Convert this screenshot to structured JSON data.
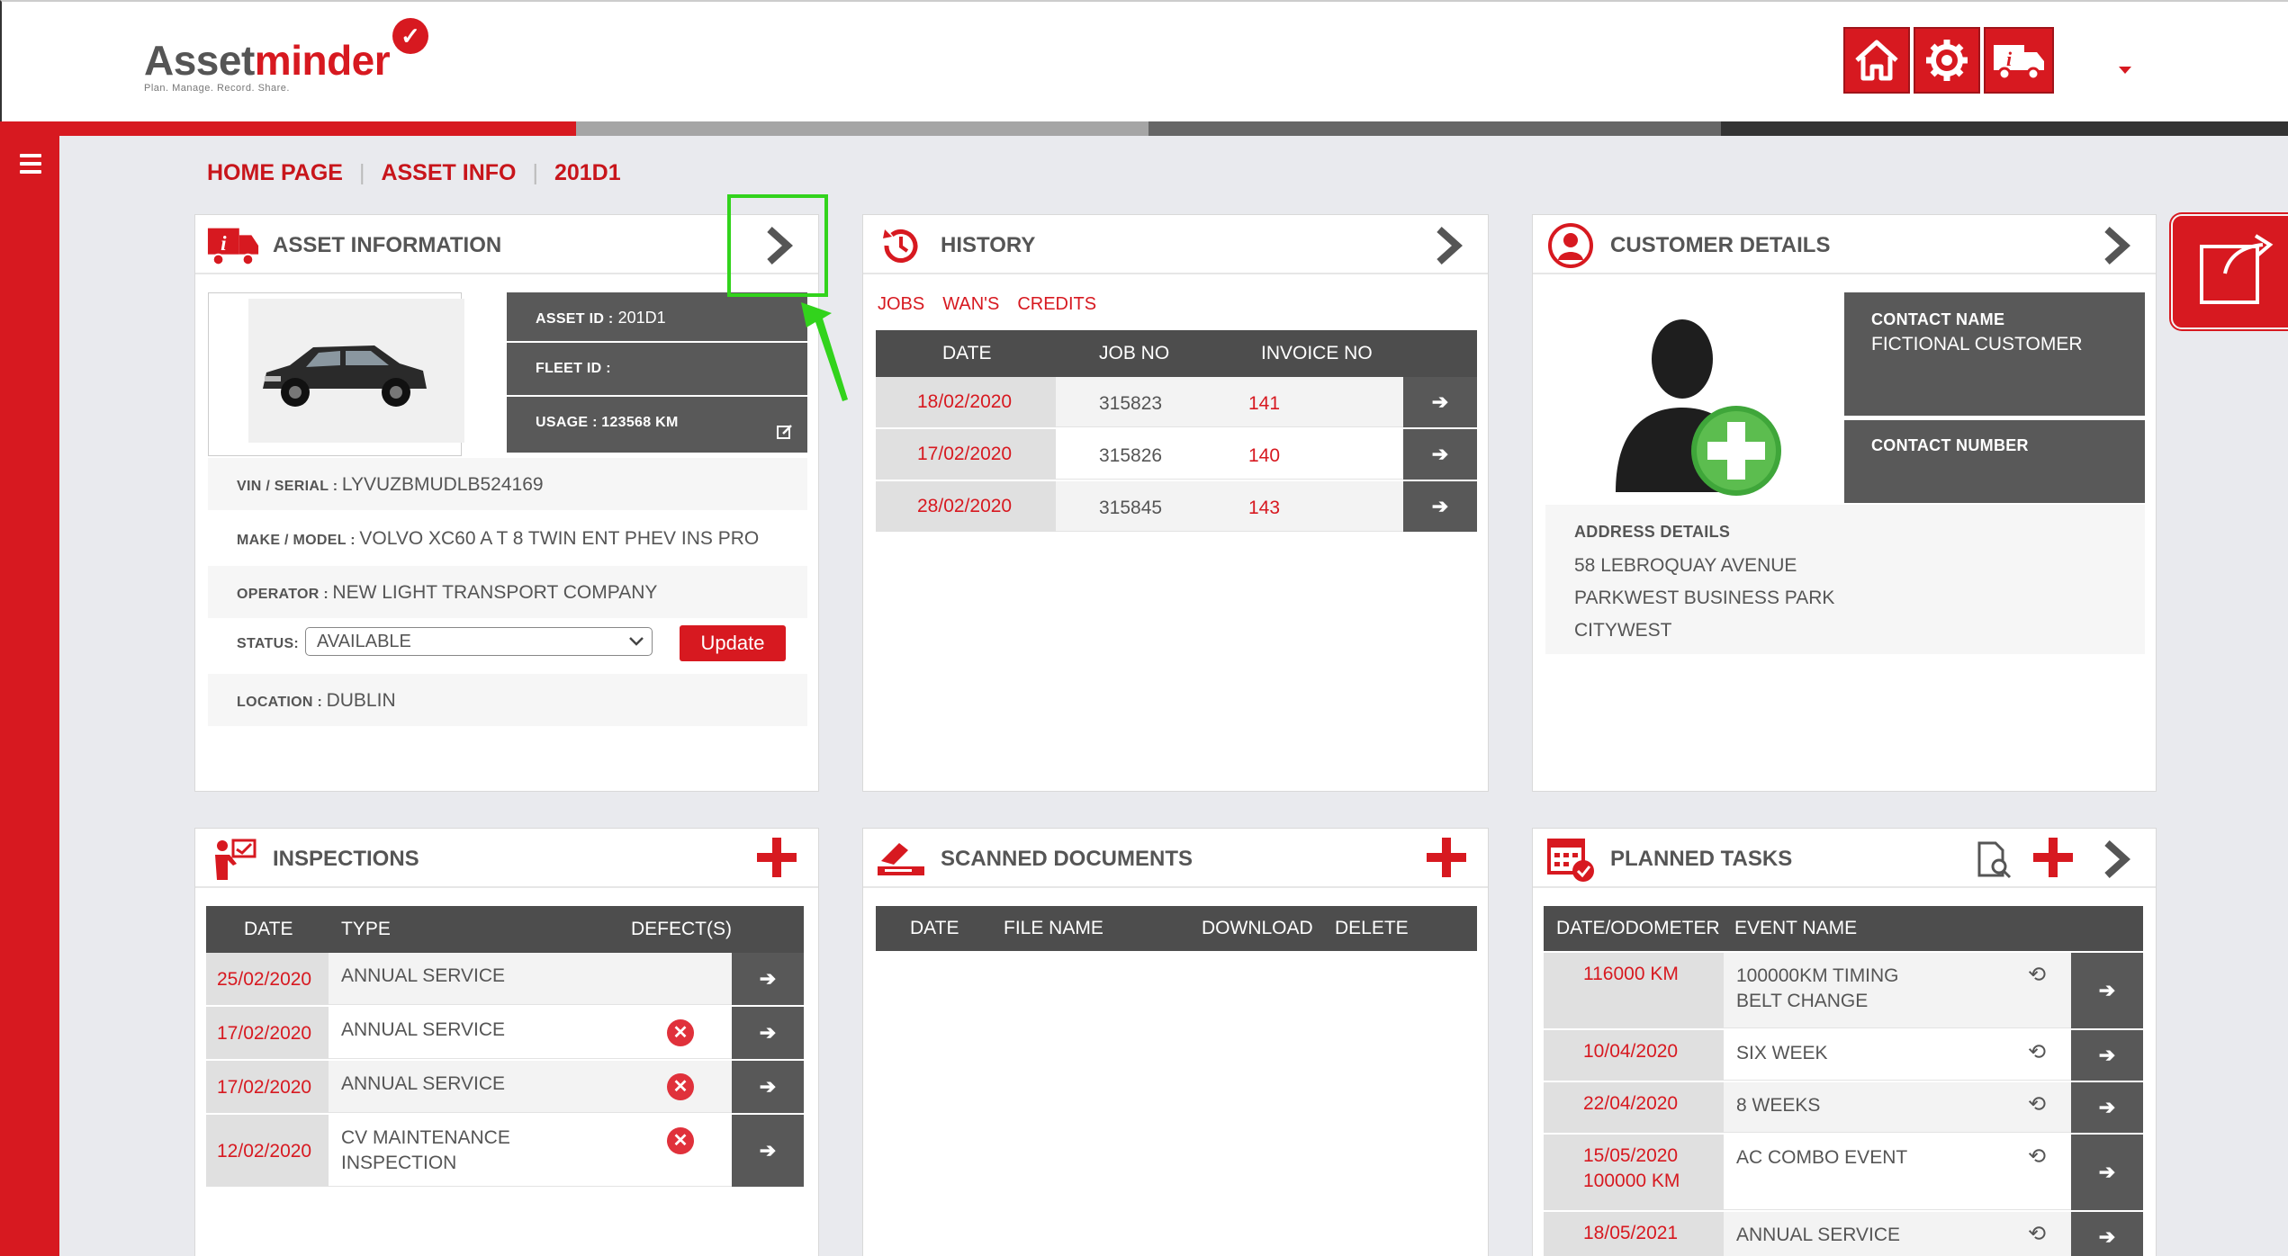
{
  "app": {
    "logo_text_a": "Asset",
    "logo_text_b": "minder",
    "logo_tagline": "Plan. Manage. Record. Share."
  },
  "header": {
    "buttons": [
      {
        "icon": "home-icon"
      },
      {
        "icon": "settings-icon"
      },
      {
        "icon": "truck-info-icon"
      }
    ]
  },
  "breadcrumb": {
    "home": "HOME PAGE",
    "asset_info": "ASSET INFO",
    "asset": "201D1"
  },
  "asset_info": {
    "title": "ASSET INFORMATION",
    "asset_id_label": "ASSET ID :",
    "asset_id": "201D1",
    "fleet_id_label": "FLEET ID :",
    "fleet_id": "",
    "usage_label": "USAGE :",
    "usage": "123568 KM",
    "vin_label": "VIN / SERIAL :",
    "vin": "LYVUZBMUDLB524169",
    "make_label": "MAKE / MODEL :",
    "make": "VOLVO XC60 A T 8 TWIN ENT PHEV INS PRO",
    "operator_label": "OPERATOR :",
    "operator": "NEW LIGHT TRANSPORT COMPANY",
    "status_label": "STATUS:",
    "status_value": "AVAILABLE",
    "update_button": "Update",
    "location_label": "LOCATION :",
    "location": "DUBLIN"
  },
  "history": {
    "title": "HISTORY",
    "tabs": [
      "JOBS",
      "WAN'S",
      "CREDITS"
    ],
    "columns": [
      "DATE",
      "JOB NO",
      "INVOICE NO"
    ],
    "rows": [
      {
        "date": "18/02/2020",
        "job": "315823",
        "invoice": "141"
      },
      {
        "date": "17/02/2020",
        "job": "315826",
        "invoice": "140"
      },
      {
        "date": "28/02/2020",
        "job": "315845",
        "invoice": "143"
      }
    ]
  },
  "customer": {
    "title": "CUSTOMER DETAILS",
    "contact_name_label": "CONTACT NAME",
    "contact_name": "FICTIONAL CUSTOMER",
    "contact_number_label": "CONTACT NUMBER",
    "address_label": "ADDRESS DETAILS",
    "address_lines": [
      "58 LEBROQUAY AVENUE",
      "PARKWEST BUSINESS PARK",
      "CITYWEST"
    ]
  },
  "inspections": {
    "title": "INSPECTIONS",
    "columns": [
      "DATE",
      "TYPE",
      "DEFECT(S)"
    ],
    "rows": [
      {
        "date": "25/02/2020",
        "type_lines": [
          "ANNUAL SERVICE"
        ],
        "defect": false
      },
      {
        "date": "17/02/2020",
        "type_lines": [
          "ANNUAL SERVICE"
        ],
        "defect": true
      },
      {
        "date": "17/02/2020",
        "type_lines": [
          "ANNUAL SERVICE"
        ],
        "defect": true
      },
      {
        "date": "12/02/2020",
        "type_lines": [
          "CV MAINTENANCE",
          "INSPECTION"
        ],
        "defect": true
      }
    ]
  },
  "scanned": {
    "title": "SCANNED DOCUMENTS",
    "columns": [
      "DATE",
      "FILE NAME",
      "DOWNLOAD",
      "DELETE"
    ]
  },
  "planned": {
    "title": "PLANNED TASKS",
    "columns": [
      "DATE/ODOMETER",
      "EVENT NAME"
    ],
    "rows": [
      {
        "when_lines": [
          "116000 KM"
        ],
        "event_lines": [
          "100000KM TIMING",
          "BELT CHANGE"
        ]
      },
      {
        "when_lines": [
          "10/04/2020"
        ],
        "event_lines": [
          "SIX WEEK"
        ]
      },
      {
        "when_lines": [
          "22/04/2020"
        ],
        "event_lines": [
          "8 WEEKS"
        ]
      },
      {
        "when_lines": [
          "15/05/2020",
          "100000 KM"
        ],
        "event_lines": [
          "AC COMBO EVENT"
        ]
      },
      {
        "when_lines": [
          "18/05/2021"
        ],
        "event_lines": [
          "ANNUAL SERVICE"
        ]
      }
    ]
  },
  "colors": {
    "brand_red": "#d71920",
    "dark_grey": "#4d4d4d",
    "highlight_green": "#32d31c"
  }
}
